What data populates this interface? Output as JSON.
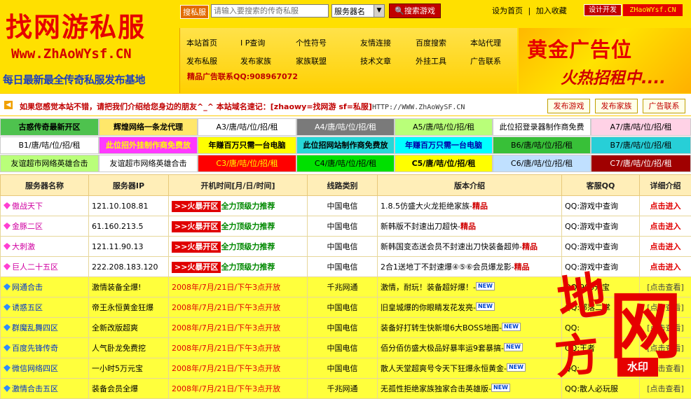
{
  "logo": {
    "title": "找网游私服",
    "domain": "Www.ZhAoWYsf.CN",
    "slogan": "每日最新最全传奇私服发布基地"
  },
  "search": {
    "label": "搜私服",
    "placeholder": "请输入要搜索的传奇私服",
    "select_value": "服务器名",
    "button": "搜索游戏"
  },
  "toplinks": [
    "设为首页",
    "|",
    "加入收藏"
  ],
  "designer": {
    "badge": "设计开发",
    "url": "ZHaoWYsf.CN"
  },
  "nav": [
    "本站首页",
    "I P查询",
    "个性符号",
    "友情连接",
    "百度搜索",
    "本站代理",
    "发布私服",
    "发布家族",
    "家族联盟",
    "技术文章",
    "外挂工具",
    "广告联系"
  ],
  "nav_ad": "精品广告联系QQ:908967072",
  "gold_ad": {
    "title": "黄金广告位",
    "subtitle": "火热招租中...."
  },
  "notice": {
    "text": "如果您感觉本站不错，请把我们介绍给您身边的朋友^_^  本站域名速记：[zhaowy=找网游 sf=私服]",
    "url": "HTTP://WWW.ZhAoWySF.CN",
    "buttons": [
      "发布游戏",
      "发布家族",
      "广告联系"
    ]
  },
  "ad_grid": [
    [
      "古惑传奇最新开区",
      "辉煌网络一条龙代理",
      "A3/唐/咭/位/招/租",
      "A4/唐/咭/位/招/租",
      "A5/唐/咭/位/招/租",
      "此位招登录器制作商免费",
      "A7/唐/咭/位/招/租"
    ],
    [
      "B1/唐/咭/位/招/租",
      "此位招外挂制作商免费放",
      "年赚百万只需一台电脑",
      "此位招网站制作商免费放",
      "年赚百万只需一台电脑",
      "B6/唐/咭/位/招/租",
      "B7/唐/咭/位/招/租"
    ],
    [
      "友谊超市网络英雄合击",
      "友谊超市网络英雄合击",
      "C3/唐/咭/位/招/租",
      "C4/唐/咭/位/招/租",
      "C5/唐/咭/位/招/租",
      "C6/唐/咭/位/招/租",
      "C7/唐/咭/位/招/租"
    ]
  ],
  "ad_colors": [
    [
      "#4ec24e",
      "#ffe76a",
      "#ffffff",
      "#7a7a7a",
      "#b9ff79",
      "#ffffff",
      "#ffd2e6"
    ],
    [
      "#ffffff",
      "#ff39ff",
      "#ffff00",
      "#27d7d7",
      "#00ffff",
      "#38c038",
      "#27cfd7"
    ],
    [
      "#b9ff79",
      "#ffffff",
      "#ff0000",
      "#00e000",
      "#ffff00",
      "#c0e0ff",
      "#a00000"
    ]
  ],
  "table": {
    "headers": [
      "服务器名称",
      "服务器IP",
      "开机时间[月/日/时间]",
      "线路类别",
      "版本介绍",
      "客服QQ",
      "详细介绍"
    ],
    "rows": [
      {
        "name": "傲战天下",
        "ip": "121.10.108.81",
        "time": ">>火暴开区",
        "strong": "全力顶级力推荐",
        "line": "中国电信",
        "ver": "1.8.5仿盛大火龙拒绝家族-",
        "tag": "精品",
        "qq": "QQ:游戏中查询",
        "detail": "点击进入"
      },
      {
        "name": "金豚二区",
        "ip": "61.160.213.5",
        "time": ">>火暴开区",
        "strong": "全力顶级力推荐",
        "line": "中国电信",
        "ver": "新韩版不封速出刀超快-",
        "tag": "精品",
        "qq": "QQ:游戏中查询",
        "detail": "点击进入"
      },
      {
        "name": "大刺激",
        "ip": "121.11.90.13",
        "time": ">>火暴开区",
        "strong": "全力顶级力推荐",
        "line": "中国电信",
        "ver": "新韩国变态送会员不封速出刀快装备超帅-",
        "tag": "精品",
        "qq": "QQ:游戏中查询",
        "detail": "点击进入"
      },
      {
        "name": "巨人二十五区",
        "ip": "222.208.183.120",
        "time": ">>火暴开区",
        "strong": "全力顶级力推荐",
        "line": "中国电信",
        "ver": "2合1送地丁不封速爆④⑤⑥会员爆龙影-",
        "tag": "精品",
        "qq": "QQ:游戏中查询",
        "detail": "点击进入"
      },
      {
        "name": "网通合击",
        "ip": "激情装备全爆!",
        "time": "2008年/7月/21日/下午3点开放",
        "line": "千兆网通",
        "ver": "激情，耐玩！装备超好爆！-",
        "tag": "NEW",
        "qq": "QQ:900元宝",
        "detail": "[点击查看]"
      },
      {
        "name": "诱惑五区",
        "ip": "帝王永恒黄金狂爆",
        "time": "2008年/7月/21日/下午3点开放",
        "line": "中国电信",
        "ver": "旧皇城爆的你眼睛发花发亮-",
        "tag": "NEW",
        "qq": "QQ:部落二掌",
        "detail": "[点击查看]"
      },
      {
        "name": "群魔乱舞四区",
        "ip": "全新改版超爽",
        "time": "2008年/7月/21日/下午3点开放",
        "line": "中国电信",
        "ver": "装备好打转生快新增6大BOSS地图-",
        "tag": "NEW",
        "qq": "QQ:",
        "detail": "[点击查看]"
      },
      {
        "name": "百度先锋传奇",
        "ip": "人气卧龙免费挖",
        "time": "2008年/7月/21日/下午3点开放",
        "line": "中国电信",
        "ver": "佰分佰仿盛大极品好暴率运9套暴搞-",
        "tag": "NEW",
        "qq": "QQ:王者",
        "detail": "[点击查看]"
      },
      {
        "name": "微信网络四区",
        "ip": "一小时5万元宝",
        "time": "2008年/7月/21日/下午3点开放",
        "line": "中国电信",
        "ver": "散人天堂超爽号令天下狂爆永恒黄金-",
        "tag": "NEW",
        "qq": "QQ:",
        "detail": "[点击查看]"
      },
      {
        "name": "激情合击五区",
        "ip": "装备会员全爆",
        "time": "2008年/7月/21日/下午3点开放",
        "line": "千兆网通",
        "ver": "无孤性拒绝家族独家合击英雄版-",
        "tag": "NEW",
        "qq": "QQ:散人必玩服",
        "detail": "[点击查看]"
      }
    ]
  },
  "watermark": {
    "chars": [
      "地",
      "方",
      "网"
    ],
    "badge": "水印"
  }
}
